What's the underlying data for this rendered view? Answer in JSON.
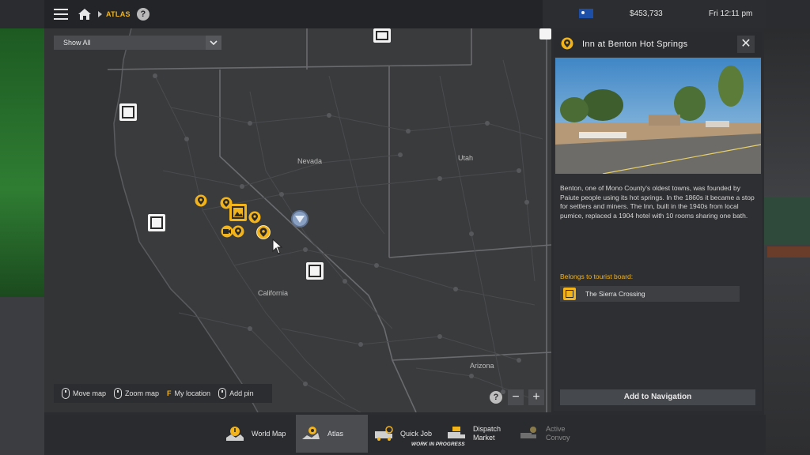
{
  "topbar": {
    "breadcrumb": "ATLAS",
    "money": "$453,733",
    "clock": "Fri 12:11 pm"
  },
  "map": {
    "filter_label": "Show All",
    "state_labels": [
      "Nevada",
      "Utah",
      "California",
      "Arizona"
    ],
    "controls": [
      {
        "key": "",
        "label": "Move map"
      },
      {
        "key": "",
        "label": "Zoom map"
      },
      {
        "key": "F",
        "label": "My location"
      },
      {
        "key": "",
        "label": "Add pin"
      }
    ],
    "zoom_help": "?",
    "zoom_out": "−",
    "zoom_in": "+"
  },
  "panel": {
    "title": "Inn at Benton Hot Springs",
    "close": "✕",
    "description": "Benton, one of Mono County's oldest towns, was founded by Paiute people using its hot springs. In the 1860s it became a stop for settlers and miners. The Inn, built in the 1940s from local pumice, replaced a 1904 hotel with 10 rooms sharing one bath.",
    "belongs_label": "Belongs to tourist board:",
    "tourist_board": "The Sierra Crossing",
    "add_nav_label": "Add to Navigation"
  },
  "bottom_tabs": [
    {
      "label": "World Map",
      "sub": "",
      "state": "normal"
    },
    {
      "label": "Atlas",
      "sub": "",
      "state": "active"
    },
    {
      "label": "Quick Job",
      "sub": "WORK IN PROGRESS",
      "state": "normal"
    },
    {
      "label": "Dispatch\nMarket",
      "sub": "",
      "state": "normal"
    },
    {
      "label": "Active\nConvoy",
      "sub": "",
      "state": "disabled"
    }
  ],
  "colors": {
    "accent": "#f2b31b",
    "panel_bg": "#2e2f32",
    "map_bg": "#3a3b3d"
  }
}
